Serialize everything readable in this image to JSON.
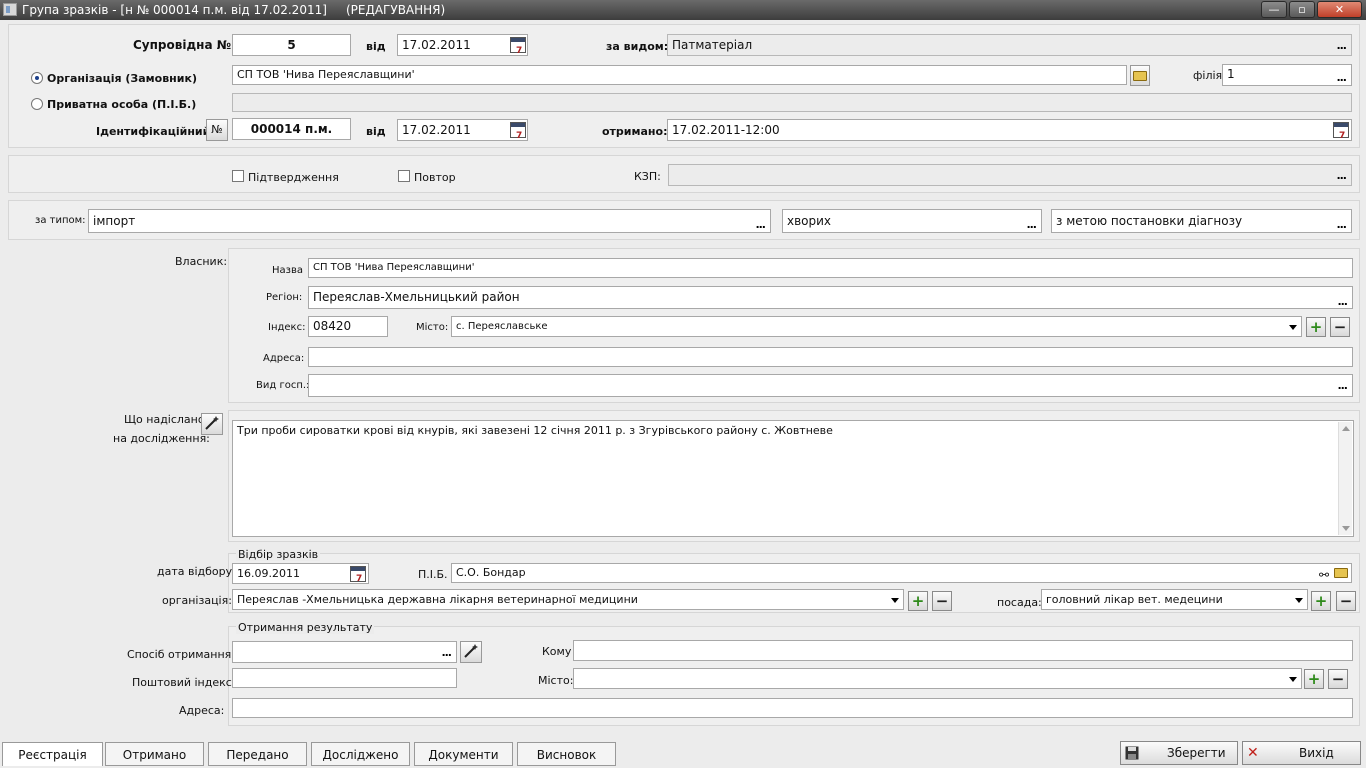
{
  "window": {
    "title": "Група зразків - [н № 000014 п.м. від 17.02.2011]     (РЕДАГУВАННЯ)",
    "minimize": "—",
    "maximize": "▫",
    "close": "✕"
  },
  "header": {
    "soprovidna_label": "Супровідна №",
    "soprovidna_value": "5",
    "vid_label": "від",
    "soprovidna_date": "17.02.2011",
    "za_vydom_label": "за видом:",
    "za_vydom_value": "Патматеріал",
    "org_radio_label": "Організація (Замовник)",
    "org_value": "СП ТОВ 'Нива Переяславщини'",
    "filia_label": "філія:",
    "filia_value": "1",
    "private_radio_label": "Приватна особа (П.І.Б.)",
    "private_value": "",
    "ident_label": "Ідентифікаційний",
    "ident_no_btn": "№",
    "ident_value": "000014 п.м.",
    "ident_vid_label": "від",
    "ident_date": "17.02.2011",
    "otrymano_label": "отримано:",
    "otrymano_value": "17.02.2011-12:00"
  },
  "flags": {
    "confirm_label": "Підтвердження",
    "repeat_label": "Повтор",
    "kzp_label": "КЗП:",
    "kzp_value": ""
  },
  "type_row": {
    "za_typom_label": "за типом:",
    "type_value": "імпорт",
    "disease_value": "хворих",
    "purpose_value": "з метою постановки діагнозу"
  },
  "owner": {
    "section_label": "Власник:",
    "name_label": "Назва",
    "name_value": "СП ТОВ 'Нива Переяславщини'",
    "region_label": "Регіон:",
    "region_value": "Переяслав-Хмельницький район",
    "index_label": "Індекс:",
    "index_value": "08420",
    "city_label": "Місто:",
    "city_value": "с. Переяславське",
    "address_label": "Адреса:",
    "address_value": "",
    "farm_label": "Вид госп.:",
    "farm_value": ""
  },
  "sent": {
    "label_line1": "Що надіслано",
    "label_line2": "на дослідження:",
    "text": "Три проби сироватки крові від кнурів, які завезені 12 січня 2011 р. з Згурівського району с. Жовтневе"
  },
  "sampling": {
    "group_title": "Відбір зразків",
    "date_label": "дата відбору:",
    "date_value": "16.09.2011",
    "pib_label": "П.І.Б.",
    "pib_value": "С.О. Бондар",
    "org_label": "організація:",
    "org_value": "Переяслав -Хмельницька державна лікарня ветеринарної медицини",
    "position_label": "посада:",
    "position_value": "головний лікар вет. медецини"
  },
  "results": {
    "group_title": "Отримання результату",
    "method_label": "Спосіб отримання:",
    "method_value": "",
    "to_label": "Кому",
    "to_value": "",
    "postal_label": "Поштовий індекс:",
    "postal_value": "",
    "city_label": "Місто:",
    "city_value": "",
    "address_label": "Адреса:",
    "address_value": ""
  },
  "tabs": [
    "Реєстрація",
    "Отримано",
    "Передано",
    "Досліджено",
    "Документи",
    "Висновок"
  ],
  "actions": {
    "save": "Зберегти",
    "exit": "Вихід"
  }
}
